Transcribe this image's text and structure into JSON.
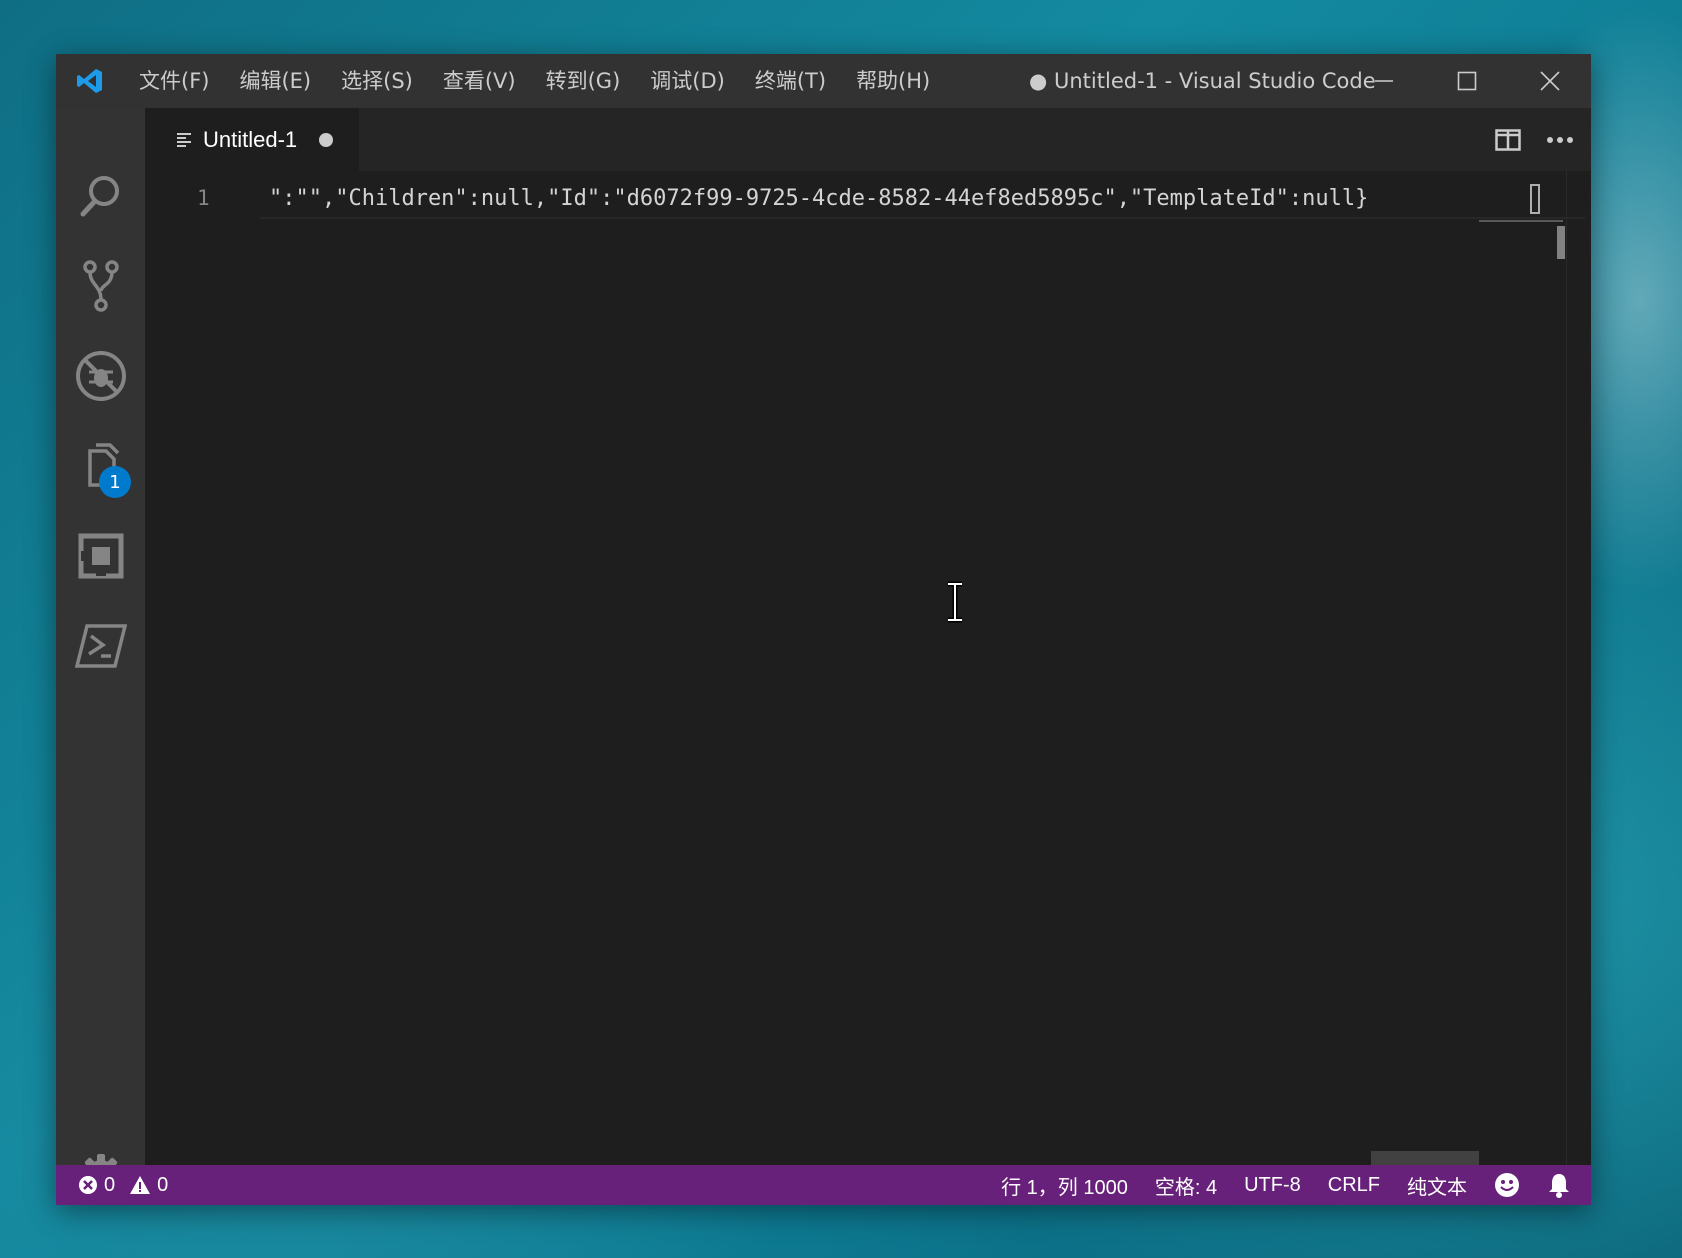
{
  "titlebar": {
    "menu": [
      "文件(F)",
      "编辑(E)",
      "选择(S)",
      "查看(V)",
      "转到(G)",
      "调试(D)",
      "终端(T)",
      "帮助(H)"
    ],
    "title": "● Untitled-1 - Visual Studio Code"
  },
  "activity": {
    "items": [
      "search-icon",
      "source-control-icon",
      "debug-icon",
      "explorer-icon",
      "extensions-icon",
      "terminal-icon",
      "settings-gear-icon"
    ],
    "explorer_badge": "1"
  },
  "tab": {
    "label": "Untitled-1"
  },
  "editor": {
    "line_number": "1",
    "code": "\":\"\",\"Children\":null,\"Id\":\"d6072f99-9725-4cde-8582-44ef8ed5895c\",\"TemplateId\":null}"
  },
  "statusbar": {
    "errors": "0",
    "warnings": "0",
    "position": "行 1，列 1000",
    "spaces": "空格: 4",
    "encoding": "UTF-8",
    "eol": "CRLF",
    "language": "纯文本"
  },
  "colors": {
    "statusbar": "#68217a",
    "titlebar": "#323233",
    "activitybar": "#333333",
    "editor": "#1e1e1e",
    "badge": "#007acc"
  }
}
